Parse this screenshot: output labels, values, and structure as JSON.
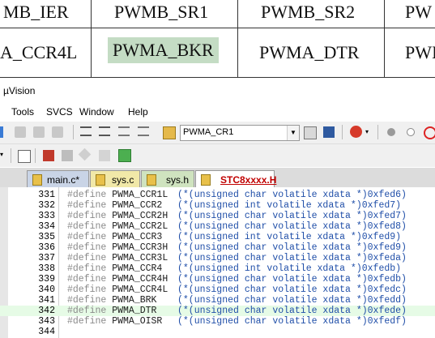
{
  "register_table": {
    "row1": [
      "MB_IER",
      "PWMB_SR1",
      "PWMB_SR2",
      "PW"
    ],
    "row2": [
      "A_CCR4L",
      "PWMA_BKR",
      "PWMA_DTR",
      "PWI"
    ]
  },
  "window": {
    "title": "µVision"
  },
  "menu": [
    "Tools",
    "SVCS",
    "Window",
    "Help"
  ],
  "toolbar": {
    "target_combo": "PWMA_CR1"
  },
  "tabs": [
    {
      "label": "main.c*",
      "active": false
    },
    {
      "label": "sys.c",
      "active": false
    },
    {
      "label": "sys.h",
      "active": false
    },
    {
      "label": "STC8xxxx.H",
      "active": true
    }
  ],
  "editor": {
    "lines": [
      {
        "num": "331",
        "kw": "#define",
        "name": "PWMA_CCR1L",
        "body": "(*(unsigned char volatile xdata *)0xfed6)"
      },
      {
        "num": "332",
        "kw": "#define",
        "name": "PWMA_CCR2",
        "body": "(*(unsigned int volatile xdata *)0xfed7)"
      },
      {
        "num": "333",
        "kw": "#define",
        "name": "PWMA_CCR2H",
        "body": "(*(unsigned char volatile xdata *)0xfed7)"
      },
      {
        "num": "334",
        "kw": "#define",
        "name": "PWMA_CCR2L",
        "body": "(*(unsigned char volatile xdata *)0xfed8)"
      },
      {
        "num": "335",
        "kw": "#define",
        "name": "PWMA_CCR3",
        "body": "(*(unsigned int volatile xdata *)0xfed9)"
      },
      {
        "num": "336",
        "kw": "#define",
        "name": "PWMA_CCR3H",
        "body": "(*(unsigned char volatile xdata *)0xfed9)"
      },
      {
        "num": "337",
        "kw": "#define",
        "name": "PWMA_CCR3L",
        "body": "(*(unsigned char volatile xdata *)0xfeda)"
      },
      {
        "num": "338",
        "kw": "#define",
        "name": "PWMA_CCR4",
        "body": "(*(unsigned int volatile xdata *)0xfedb)"
      },
      {
        "num": "339",
        "kw": "#define",
        "name": "PWMA_CCR4H",
        "body": "(*(unsigned char volatile xdata *)0xfedb)"
      },
      {
        "num": "340",
        "kw": "#define",
        "name": "PWMA_CCR4L",
        "body": "(*(unsigned char volatile xdata *)0xfedc)"
      },
      {
        "num": "341",
        "kw": "#define",
        "name": "PWMA_BRK",
        "body": "(*(unsigned char volatile xdata *)0xfedd)"
      },
      {
        "num": "342",
        "kw": "#define",
        "name": "PWMA_DTR",
        "body": "(*(unsigned char volatile xdata *)0xfede)"
      },
      {
        "num": "343",
        "kw": "#define",
        "name": "PWMA_OISR",
        "body": "(*(unsigned char volatile xdata *)0xfedf)"
      },
      {
        "num": "344",
        "kw": "",
        "name": "",
        "body": ""
      }
    ]
  }
}
